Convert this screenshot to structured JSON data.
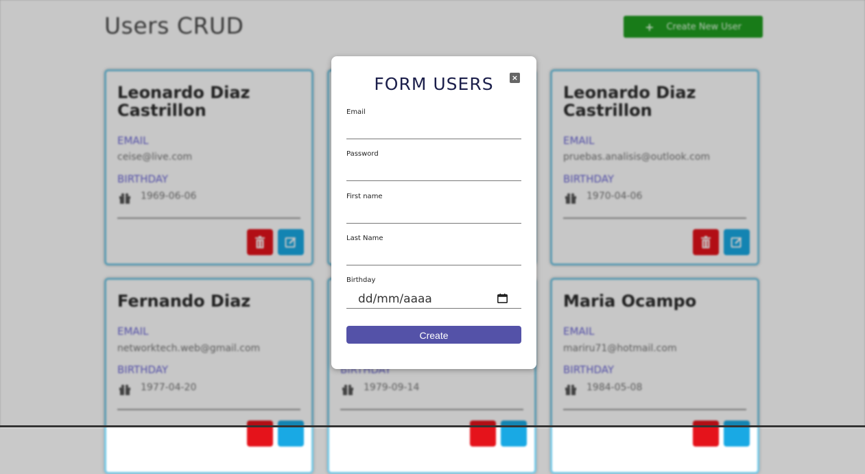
{
  "page": {
    "title": "Users CRUD",
    "create_button": "Create New User"
  },
  "cards": [
    {
      "name": "Leonardo Diaz Castrillon",
      "email_label": "EMAIL",
      "email": "ceise@live.com",
      "birthday_label": "BIRTHDAY",
      "birthday": "1969-06-06"
    },
    {
      "name": "Leonardo Diaz Castrillon",
      "email_label": "EMAIL",
      "email": "pruebas.analisis@outlook.com",
      "birthday_label": "BIRTHDAY",
      "birthday": "1970-04-06"
    },
    {
      "name": "Fernando Diaz",
      "email_label": "EMAIL",
      "email": "networktech.web@gmail.com",
      "birthday_label": "BIRTHDAY",
      "birthday": "1977-04-20"
    },
    {
      "name": "",
      "email_label": "",
      "email": "",
      "birthday_label": "BIRTHDAY",
      "birthday": "1979-09-14"
    },
    {
      "name": "Maria Ocampo",
      "email_label": "EMAIL",
      "email": "mariru71@hotmail.com",
      "birthday_label": "BIRTHDAY",
      "birthday": "1984-05-08"
    }
  ],
  "modal": {
    "title": "FORM USERS",
    "close": "×",
    "fields": {
      "email": {
        "label": "Email",
        "value": ""
      },
      "password": {
        "label": "Password",
        "value": ""
      },
      "first_name": {
        "label": "First name",
        "value": ""
      },
      "last_name": {
        "label": "Last Name",
        "value": ""
      },
      "birthday": {
        "label": "Birthday",
        "value": "dd/mm/aaaa"
      }
    },
    "submit_label": "Create"
  },
  "colors": {
    "accent": "#5452a8",
    "create_green": "#1f9e1f",
    "delete_red": "#e5131b",
    "edit_blue": "#19a9e4",
    "label_purple": "#6b66d6",
    "card_border": "#77c9e6"
  },
  "icons": {
    "create": "plus-icon",
    "delete": "trash-icon",
    "edit": "edit-icon",
    "birthday": "gift-icon",
    "close": "close-icon",
    "date": "calendar-icon"
  }
}
